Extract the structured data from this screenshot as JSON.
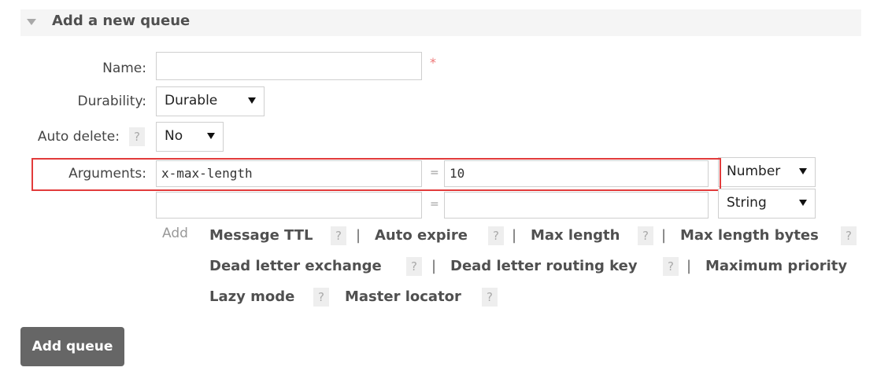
{
  "section": {
    "title": "Add a new queue"
  },
  "form": {
    "name_label": "Name:",
    "name_value": "",
    "required_marker": "*",
    "durability_label": "Durability:",
    "durability_value": "Durable",
    "auto_delete_label": "Auto delete:",
    "auto_delete_value": "No",
    "arguments_label": "Arguments:",
    "arguments": [
      {
        "key": "x-max-length",
        "value": "10",
        "type": "Number"
      },
      {
        "key": "",
        "value": "",
        "type": "String"
      }
    ],
    "equals": "=",
    "help": "?",
    "add_label": "Add"
  },
  "shortcuts": [
    "Message TTL",
    "Auto expire",
    "Max length",
    "Max length bytes",
    "Dead letter exchange",
    "Dead letter routing key",
    "Maximum priority",
    "Lazy mode",
    "Master locator"
  ],
  "separator": "|",
  "add_queue_button": "Add queue",
  "colors": {
    "highlight": "#e23b3b",
    "button": "#666666"
  }
}
